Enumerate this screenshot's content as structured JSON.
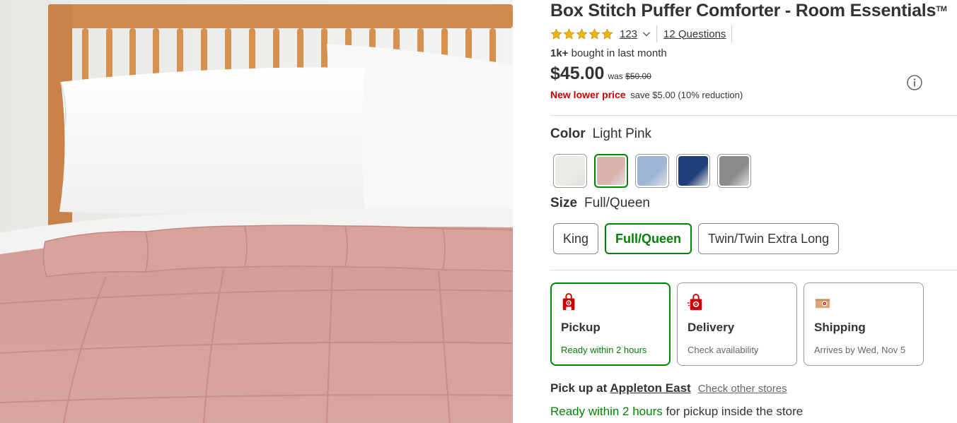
{
  "product": {
    "title": "Box Stitch Puffer Comforter - Room Essentials",
    "trademark": "TM",
    "rating_stars": 5,
    "rating_count": "123",
    "questions_link": "12 Questions",
    "bought_bold": "1k+",
    "bought_rest": " bought in last month",
    "price": "$45.00",
    "was_prefix": "was ",
    "was_price": "$50.00",
    "new_lower_price": "New lower price",
    "save_text": "save $5.00 (10% reduction)"
  },
  "color": {
    "label": "Color",
    "selected_value": "Light Pink",
    "swatches": [
      {
        "name": "White",
        "hex": "#ecebe6"
      },
      {
        "name": "Light Pink",
        "hex": "#d9b1ad"
      },
      {
        "name": "Light Blue",
        "hex": "#9db5d6"
      },
      {
        "name": "Navy",
        "hex": "#1f3e7a"
      },
      {
        "name": "Gray",
        "hex": "#8c8c8c"
      }
    ]
  },
  "size": {
    "label": "Size",
    "selected_value": "Full/Queen",
    "options": [
      "King",
      "Full/Queen",
      "Twin/Twin Extra Long"
    ]
  },
  "fulfillment": [
    {
      "title": "Pickup",
      "subtitle": "Ready within 2 hours",
      "icon": "store-bag-icon"
    },
    {
      "title": "Delivery",
      "subtitle": "Check availability",
      "icon": "delivery-bag-icon"
    },
    {
      "title": "Shipping",
      "subtitle": "Arrives by Wed, Nov 5",
      "icon": "shipping-box-icon"
    }
  ],
  "pickup": {
    "prefix": "Pick up at ",
    "store": "Appleton East",
    "check_other": "Check other stores",
    "ready_green": "Ready within 2 hours",
    "ready_rest": " for pickup inside the store"
  },
  "colors": {
    "accent_green": "#008300",
    "sale_red": "#cc0000",
    "star_gold": "#f0b400",
    "target_red": "#cc0000"
  }
}
